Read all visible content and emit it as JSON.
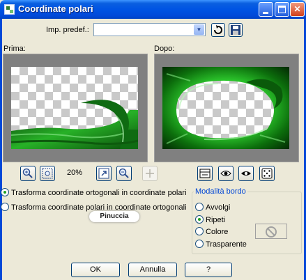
{
  "window": {
    "title": "Coordinate polari",
    "icon": "app-icon",
    "minimize_icon": "minimize-icon",
    "maximize_icon": "maximize-icon",
    "close_glyph": "✕"
  },
  "preset": {
    "label": "Imp. predef.:",
    "value": "",
    "dropdown_glyph": "▼",
    "reset_icon": "reset-icon",
    "save_icon": "floppy-disk-icon"
  },
  "previews": {
    "before_label": "Prima:",
    "after_label": "Dopo:"
  },
  "zoom": {
    "percent": "20%",
    "zoom_in_icon": "zoom-in-icon",
    "zoom_out_icon": "zoom-out-icon",
    "zoom_fit_icon": "zoom-fit-icon",
    "zoom_100_icon": "zoom-100-icon",
    "pan_icon": "pan-icon"
  },
  "view_tools": {
    "icons": [
      "proof-window-icon",
      "eye-1-icon",
      "eye-2-icon",
      "randomize-dice-icon"
    ]
  },
  "conversion": {
    "options": [
      {
        "label": "Trasforma coordinate ortogonali in coordinate polari",
        "selected": true
      },
      {
        "label": "Trasforma coordinate polari in coordinate ortogonali",
        "selected": false
      }
    ]
  },
  "edge_mode": {
    "title": "Modalità bordo",
    "options": [
      {
        "label": "Avvolgi",
        "selected": false
      },
      {
        "label": "Ripeti",
        "selected": true
      },
      {
        "label": "Colore",
        "selected": false
      },
      {
        "label": "Trasparente",
        "selected": false
      }
    ],
    "color_swatch_icon": "no-color-icon"
  },
  "watermark": {
    "text": "Pinuccia"
  },
  "buttons": {
    "ok": "OK",
    "cancel": "Annulla",
    "help": "?"
  },
  "colors": {
    "titlebar": "#0054e3",
    "dialog_bg": "#ece9d8",
    "accent_green": "#1a8f1a",
    "group_title": "#0046d5"
  }
}
